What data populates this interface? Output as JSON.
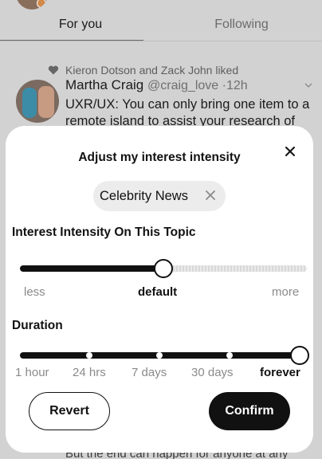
{
  "tabs": [
    {
      "label": "For you",
      "active": true
    },
    {
      "label": "Following",
      "active": false
    }
  ],
  "tweet": {
    "liked_by": "Kieron Dotson and Zack John liked",
    "author_name": "Martha Craig",
    "handle_time": "@craig_love ·12h",
    "body": "UXR/UX: You can only bring one item to a remote island to assist your research of",
    "bottom_text": "But the end can happen for anyone at any"
  },
  "sheet": {
    "title": "Adjust my interest intensity",
    "topic_chip": "Celebrity News",
    "intensity_label": "Interest Intensity On This Topic",
    "intensity_ticks": [
      "less",
      "default",
      "more"
    ],
    "intensity_selected": "default",
    "duration_label": "Duration",
    "duration_ticks": [
      "1 hour",
      "24 hrs",
      "7 days",
      "30 days",
      "forever"
    ],
    "duration_selected": "forever",
    "revert_label": "Revert",
    "confirm_label": "Confirm"
  },
  "icons": {
    "close": "close-icon",
    "chip_remove": "remove-icon",
    "like": "heart-icon",
    "more": "chevron-down-icon"
  },
  "colors": {
    "primary": "#111111",
    "muted": "#8a8a8a",
    "chip_bg": "#ececec"
  }
}
